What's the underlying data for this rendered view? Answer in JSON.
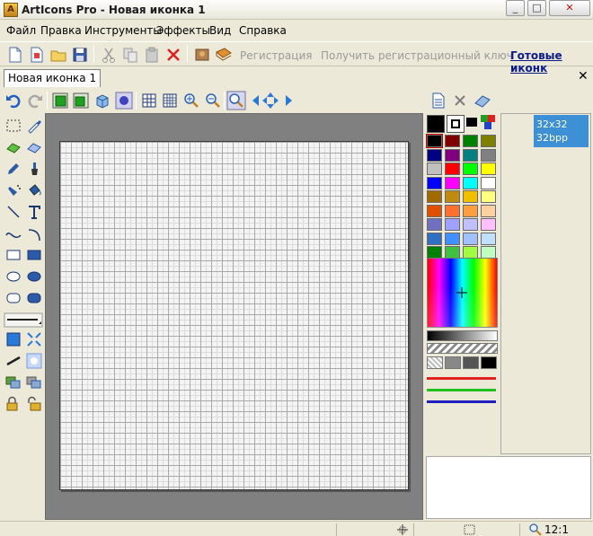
{
  "window": {
    "app_icon_letter": "A",
    "title": "ArtIcons Pro - Новая иконка 1",
    "min": "_",
    "max": "□",
    "close": "✕"
  },
  "menu": [
    "Файл",
    "Правка",
    "Инструменты",
    "Эффекты",
    "Вид",
    "Справка"
  ],
  "toolbar": {
    "register": "Регистрация",
    "get_key": "Получить регистрационный ключ",
    "ready_icons": "Готовые иконк"
  },
  "tab": {
    "label": "Новая иконка 1",
    "close": "✕"
  },
  "format": {
    "size": "32x32",
    "depth": "32bpp"
  },
  "status": {
    "zoom": "12:1"
  },
  "colors": {
    "accent": "#3d8fd6",
    "canvas_bg": "#808080"
  },
  "palette": [
    [
      "#000000",
      "#800000",
      "#008000",
      "#808000"
    ],
    [
      "#000080",
      "#800080",
      "#008080",
      "#808080"
    ],
    [
      "#c0c0c0",
      "#ff0000",
      "#00ff00",
      "#ffff00"
    ],
    [
      "#0000ff",
      "#ff00ff",
      "#00ffff",
      "#ffffff"
    ],
    [
      "#a06a00",
      "#c08a10",
      "#f0c000",
      "#ffff80"
    ],
    [
      "#e05000",
      "#ff7030",
      "#ffa040",
      "#ffd0a0"
    ],
    [
      "#7070c0",
      "#a0a0ff",
      "#c0c0ff",
      "#ffc0ff"
    ],
    [
      "#3070c0",
      "#4090ff",
      "#a0c0ff",
      "#c0e0ff"
    ],
    [
      "#008000",
      "#40c040",
      "#a0ff40",
      "#c0ffc0"
    ]
  ]
}
